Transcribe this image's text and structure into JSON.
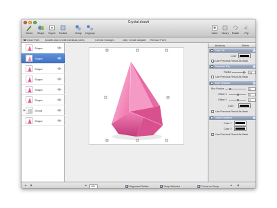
{
  "window": {
    "title": "Crystal.drawit"
  },
  "toolbar": {
    "left": [
      {
        "label": "Vector",
        "icon": "pencil-icon"
      },
      {
        "label": "Shape",
        "icon": "shape-icon"
      },
      {
        "label": "Export",
        "icon": "export-icon"
      },
      {
        "label": "Position",
        "icon": "position-icon"
      },
      {
        "label": "Group",
        "icon": "group-icon"
      },
      {
        "label": "Ungroup",
        "icon": "ungroup-icon"
      }
    ],
    "right": [
      {
        "label": "Insert",
        "icon": "insert-icon"
      },
      {
        "label": "Library",
        "icon": "library-icon"
      },
      {
        "label": "Rotate",
        "icon": "rotate-icon"
      },
      {
        "label": "Flip",
        "icon": "flip-icon"
      }
    ]
  },
  "hintbar": {
    "close_path": "Close Path",
    "double_click": "Double-click to edit individual points",
    "commit": "Commit Changes",
    "ctrl_click": "click: Create subpath",
    "remove_point": "Remove Point"
  },
  "layers": [
    {
      "name": "Shape",
      "selected": false,
      "thumb_color": "#e8559b"
    },
    {
      "name": "Shape",
      "selected": true,
      "thumb_color": "#f07fb6"
    },
    {
      "name": "Shape",
      "selected": false,
      "thumb_color": "#e8559b"
    },
    {
      "name": "Shape",
      "selected": false,
      "thumb_color": "#e8559b"
    },
    {
      "name": "Shape",
      "selected": false,
      "thumb_color": "#e8559b"
    },
    {
      "name": "Shape",
      "selected": false,
      "thumb_color": "#e8559b"
    },
    {
      "name": "Group",
      "selected": false,
      "thumb_color": "#cfcfcf"
    },
    {
      "name": "Shape",
      "selected": false,
      "thumb_color": "#e8559b"
    }
  ],
  "inspector": {
    "tabs": {
      "attributes": "Attributes",
      "effects": "Effects"
    },
    "color_fill": {
      "title": "Color Fill",
      "color_label": "Color",
      "color": "#000000"
    },
    "use_previous_1": "Use Previous Result As Mask",
    "gaussian_blur": {
      "title": "Gaussian Blur",
      "radius_label": "Radius",
      "radius_value": "10"
    },
    "use_previous_2": "Use Previous Result As Mask",
    "inner_shadow": {
      "title": "Inner Shadow",
      "blur_label": "Blur Radius",
      "blur_value": "5",
      "offx_label": "Offset X",
      "offx_value": "0",
      "offy_label": "Offset Y",
      "offy_value": "0",
      "color_label": "Color",
      "color": "#000000"
    },
    "use_previous_3": "Use Previous Result As Mask",
    "linear_gradient": {
      "title": "Linear Gradient",
      "color1_label": "Color 1",
      "color1": "#000000",
      "color2_label": "Color 2",
      "color2": "#000000"
    },
    "use_previous_4": "Use Previous Result As Mask"
  },
  "bottombar": {
    "zoom": "100",
    "alignment_guides": "Alignment Guides",
    "snap_selected": "Snap Selected",
    "focus_on_group": "Focus on Group"
  },
  "colors": {
    "crystal_light": "#f9b7d6",
    "crystal_mid": "#ee6aa6",
    "crystal_dark": "#c83b7f",
    "selection": "#3f72c3"
  }
}
